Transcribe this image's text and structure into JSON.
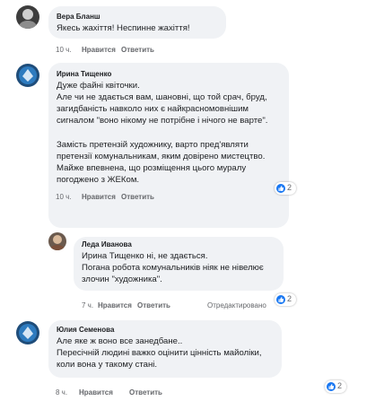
{
  "labels": {
    "like": "Нравится",
    "reply": "Ответить",
    "edited": "Отредактировано"
  },
  "comments": [
    {
      "author": "Вера Бланш",
      "lines": [
        "Якесь жахіття! Неспинне жахіття!"
      ],
      "time": "10 ч."
    },
    {
      "author": "Ирина Тищенко",
      "lines": [
        "Дуже файні квіточки.",
        "Але чи не здається вам, шановні, що той срач, бруд,",
        "загидбаність навколо них є найкрасномовнішим",
        "сигналом \"воно нікому не потрібне і нічого не варте\".",
        "",
        "Замість претензій художнику, варто пред'являти",
        "претензії комунальникам, яким довірено мистецтво.",
        "Майже впевнена, що розміщення цього муралу",
        "погоджено з ЖЕКом."
      ],
      "time": "10 ч.",
      "reactions": "2"
    },
    {
      "author": "Леда Иванова",
      "lines": [
        "Ирина Тищенко ні, не здається.",
        "Погана робота комунальників ніяк не нівелює",
        "злочин \"художника\"."
      ],
      "time": "7 ч.",
      "reactions": "2"
    },
    {
      "author": "Юлия Семенова",
      "lines": [
        "Але яке ж воно все занедбане..",
        "Пересічній людині важко оцінити цінність майоліки,",
        "коли вона у такому стані."
      ],
      "time": "8 ч.",
      "reactions": "2"
    }
  ],
  "colors": {
    "like_blue": "#1877f2",
    "bubble": "#f0f2f5",
    "meta_gray": "#65676b"
  }
}
